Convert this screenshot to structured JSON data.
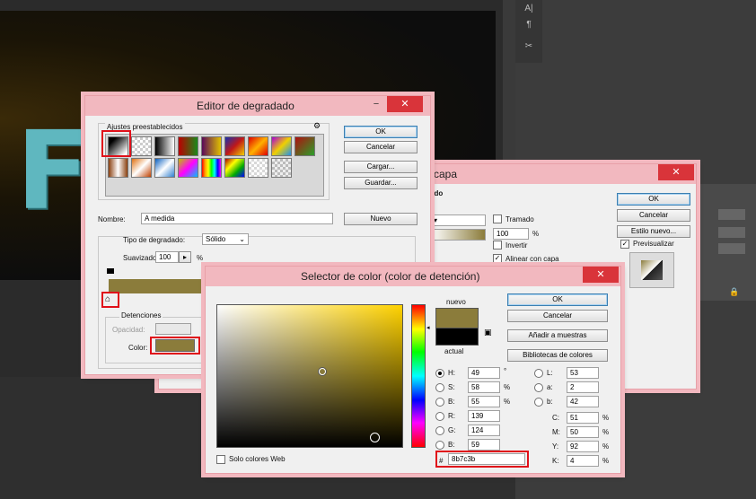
{
  "background": {
    "logo_letter": "F"
  },
  "gradient_editor": {
    "title": "Editor de degradado",
    "presets_label": "Ajustes preestablecidos",
    "ok": "OK",
    "cancel": "Cancelar",
    "load": "Cargar...",
    "save": "Guardar...",
    "name_label": "Nombre:",
    "name_value": "A medida",
    "new_button": "Nuevo",
    "gradient_type_label": "Tipo de degradado:",
    "gradient_type_value": "Sólido",
    "smoothness_label": "Suavizado:",
    "smoothness_value": "100",
    "smoothness_unit": "%",
    "stops_label": "Detenciones",
    "opacity_label": "Opacidad:",
    "color_label": "Color:",
    "stop_color": "#8b7c3b"
  },
  "layer_style": {
    "title_fragment": "e capa",
    "section_fragment": "ado",
    "ok": "OK",
    "cancel": "Cancelar",
    "new_style": "Estilo nuevo...",
    "preview_label": "Previsualizar",
    "dither_label": "Tramado",
    "reverse_label": "Invertir",
    "align_label": "Alinear con capa",
    "opacity_value": "100",
    "opacity_unit": "%"
  },
  "color_picker": {
    "title": "Selector de color (color de detención)",
    "ok": "OK",
    "cancel": "Cancelar",
    "add_swatches": "Añadir a muestras",
    "color_libraries": "Bibliotecas de colores",
    "new_label": "nuevo",
    "current_label": "actual",
    "new_color": "#8b7c3b",
    "current_color": "#000000",
    "web_colors_label": "Solo colores Web",
    "hex_symbol": "#",
    "hex_value": "8b7c3b",
    "hsb": [
      {
        "label": "H:",
        "value": "49",
        "unit": "°"
      },
      {
        "label": "S:",
        "value": "58",
        "unit": "%"
      },
      {
        "label": "B:",
        "value": "55",
        "unit": "%"
      }
    ],
    "rgb": [
      {
        "label": "R:",
        "value": "139"
      },
      {
        "label": "G:",
        "value": "124"
      },
      {
        "label": "B:",
        "value": "59"
      }
    ],
    "lab": [
      {
        "label": "L:",
        "value": "53"
      },
      {
        "label": "a:",
        "value": "2"
      },
      {
        "label": "b:",
        "value": "42"
      }
    ],
    "cmyk": [
      {
        "label": "C:",
        "value": "51",
        "unit": "%"
      },
      {
        "label": "M:",
        "value": "50",
        "unit": "%"
      },
      {
        "label": "Y:",
        "value": "92",
        "unit": "%"
      },
      {
        "label": "K:",
        "value": "4",
        "unit": "%"
      }
    ]
  }
}
